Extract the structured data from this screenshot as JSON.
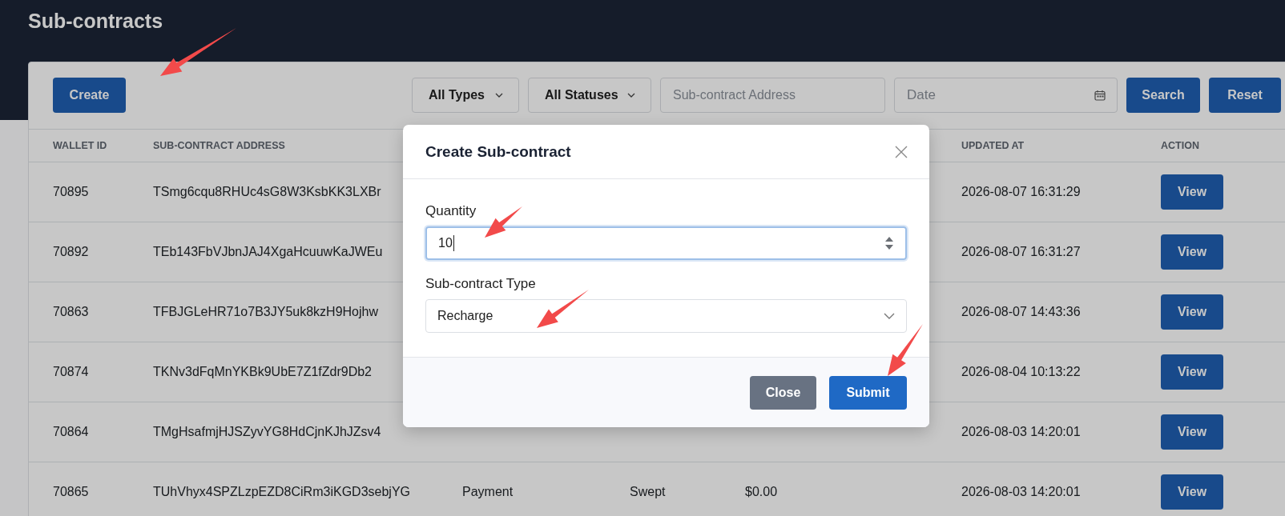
{
  "page_title": "Sub-contracts",
  "toolbar": {
    "create_button": "Create",
    "type_filter": "All Types",
    "status_filter": "All Statuses",
    "address_field": {
      "placeholder": "Sub-contract Address"
    },
    "date_field": {
      "placeholder": "Date"
    },
    "search_button": "Search",
    "reset_button": "Reset"
  },
  "table": {
    "columns": [
      "WALLET ID",
      "SUB-CONTRACT ADDRESS",
      "",
      "",
      "",
      "UPDATED AT",
      "ACTION"
    ],
    "rows": [
      {
        "wallet_id": "70895",
        "address": "TSmg6cqu8RHUc4sG8W3KsbKK3LXBr",
        "updated_at": "2026-08-07 16:31:29",
        "action": "View"
      },
      {
        "wallet_id": "70892",
        "address": "TEb143FbVJbnJAJ4XgaHcuuwKaJWEu",
        "updated_at": "2026-08-07 16:31:27",
        "action": "View"
      },
      {
        "wallet_id": "70863",
        "address": "TFBJGLeHR71o7B3JY5uk8kzH9Hojhw",
        "updated_at": "2026-08-07 14:43:36",
        "action": "View"
      },
      {
        "wallet_id": "70874",
        "address": "TKNv3dFqMnYKBk9UbE7Z1fZdr9Db2",
        "updated_at": "2026-08-04 10:13:22",
        "action": "View"
      },
      {
        "wallet_id": "70864",
        "address": "TMgHsafmjHJSZyvYG8HdCjnKJhJZsv4",
        "updated_at": "2026-08-03 14:20:01",
        "action": "View"
      },
      {
        "wallet_id": "70865",
        "address": "TUhVhyx4SPZLzpEZD8CiRm3iKGD3sebjYG",
        "type": "Payment",
        "status": "Swept",
        "amount": "$0.00",
        "updated_at": "2026-08-03 14:20:01",
        "action": "View"
      }
    ]
  },
  "modal": {
    "title": "Create Sub-contract",
    "fields": [
      {
        "kind": "number",
        "label": "Quantity",
        "value": "10",
        "focused": true
      },
      {
        "kind": "select",
        "label": "Sub-contract Type",
        "value": "Recharge",
        "focused": false
      }
    ],
    "buttons": [
      {
        "kind": "secondary",
        "label": "Close"
      },
      {
        "kind": "primary",
        "label": "Submit"
      }
    ]
  },
  "annotations": [
    {
      "kind": "arrow"
    },
    {
      "kind": "arrow"
    },
    {
      "kind": "arrow"
    },
    {
      "kind": "arrow"
    }
  ]
}
